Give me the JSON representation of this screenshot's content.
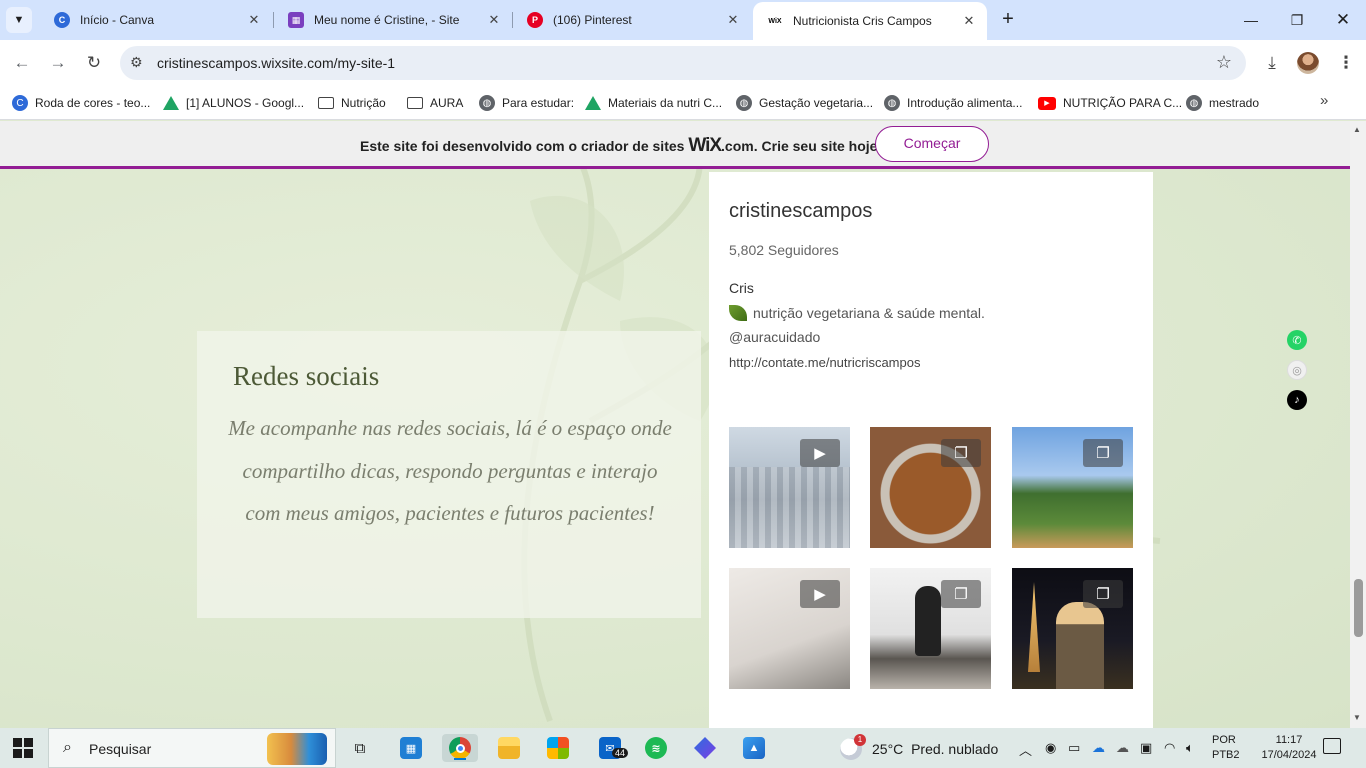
{
  "browser": {
    "tabs": [
      {
        "title": "Início - Canva",
        "favicon": "canva-icon",
        "active": false
      },
      {
        "title": "Meu nome é Cristine, - Site",
        "favicon": "site-icon",
        "active": false
      },
      {
        "title": "(106) Pinterest",
        "favicon": "pinterest-icon",
        "active": false
      },
      {
        "title": "Nutricionista Cris Campos",
        "favicon": "wix-icon",
        "active": true
      }
    ],
    "url": "cristinescampos.wixsite.com/my-site-1",
    "bookmarks": [
      {
        "label": "Roda de cores - teo...",
        "icon": "canva-icon"
      },
      {
        "label": "[1] ALUNOS - Googl...",
        "icon": "drive-icon"
      },
      {
        "label": "Nutrição",
        "icon": "folder-icon"
      },
      {
        "label": "AURA",
        "icon": "folder-icon"
      },
      {
        "label": "Para estudar:",
        "icon": "globe-icon"
      },
      {
        "label": "Materiais da nutri C...",
        "icon": "drive-icon"
      },
      {
        "label": "Gestação vegetaria...",
        "icon": "globe-icon"
      },
      {
        "label": "Introdução alimenta...",
        "icon": "globe-icon"
      },
      {
        "label": "NUTRIÇÃO PARA C...",
        "icon": "youtube-icon"
      },
      {
        "label": "mestrado",
        "icon": "globe-icon"
      }
    ]
  },
  "wix_banner": {
    "text_before": "Este site foi desenvolvido com o criador de sites",
    "logo": "WiX",
    "logo_suffix": ".com",
    "text_after": ". Crie seu site hoje.",
    "button": "Começar"
  },
  "social": {
    "title": "Redes sociais",
    "body": "Me acompanhe nas redes sociais, lá é o espaço onde compartilho dicas, respondo perguntas e interajo com meus amigos, pacientes e futuros pacientes!"
  },
  "instagram": {
    "username": "cristinescampos",
    "followers": "5,802 Seguidores",
    "name": "Cris",
    "bio": "nutrição vegetariana & saúde mental.",
    "handle": "@auracuidado",
    "link": "http://contate.me/nutricriscampos",
    "posts": [
      {
        "type": "reel",
        "caption": ""
      },
      {
        "type": "carousel",
        "caption": ""
      },
      {
        "type": "carousel",
        "caption": ""
      },
      {
        "type": "reel",
        "caption": ""
      },
      {
        "type": "carousel",
        "caption": ""
      },
      {
        "type": "carousel",
        "caption": ""
      }
    ]
  },
  "taskbar": {
    "search": "Pesquisar",
    "weather_temp": "25°C",
    "weather_desc": "Pred. nublado",
    "weather_badge": "1",
    "mail_badge": "44",
    "lang_line1": "POR",
    "lang_line2": "PTB2",
    "time": "11:17",
    "date": "17/04/2024"
  },
  "colors": {
    "wix_purple": "#931d94",
    "heading_green": "#4c5936",
    "page_bg": "#dfe9d1"
  }
}
